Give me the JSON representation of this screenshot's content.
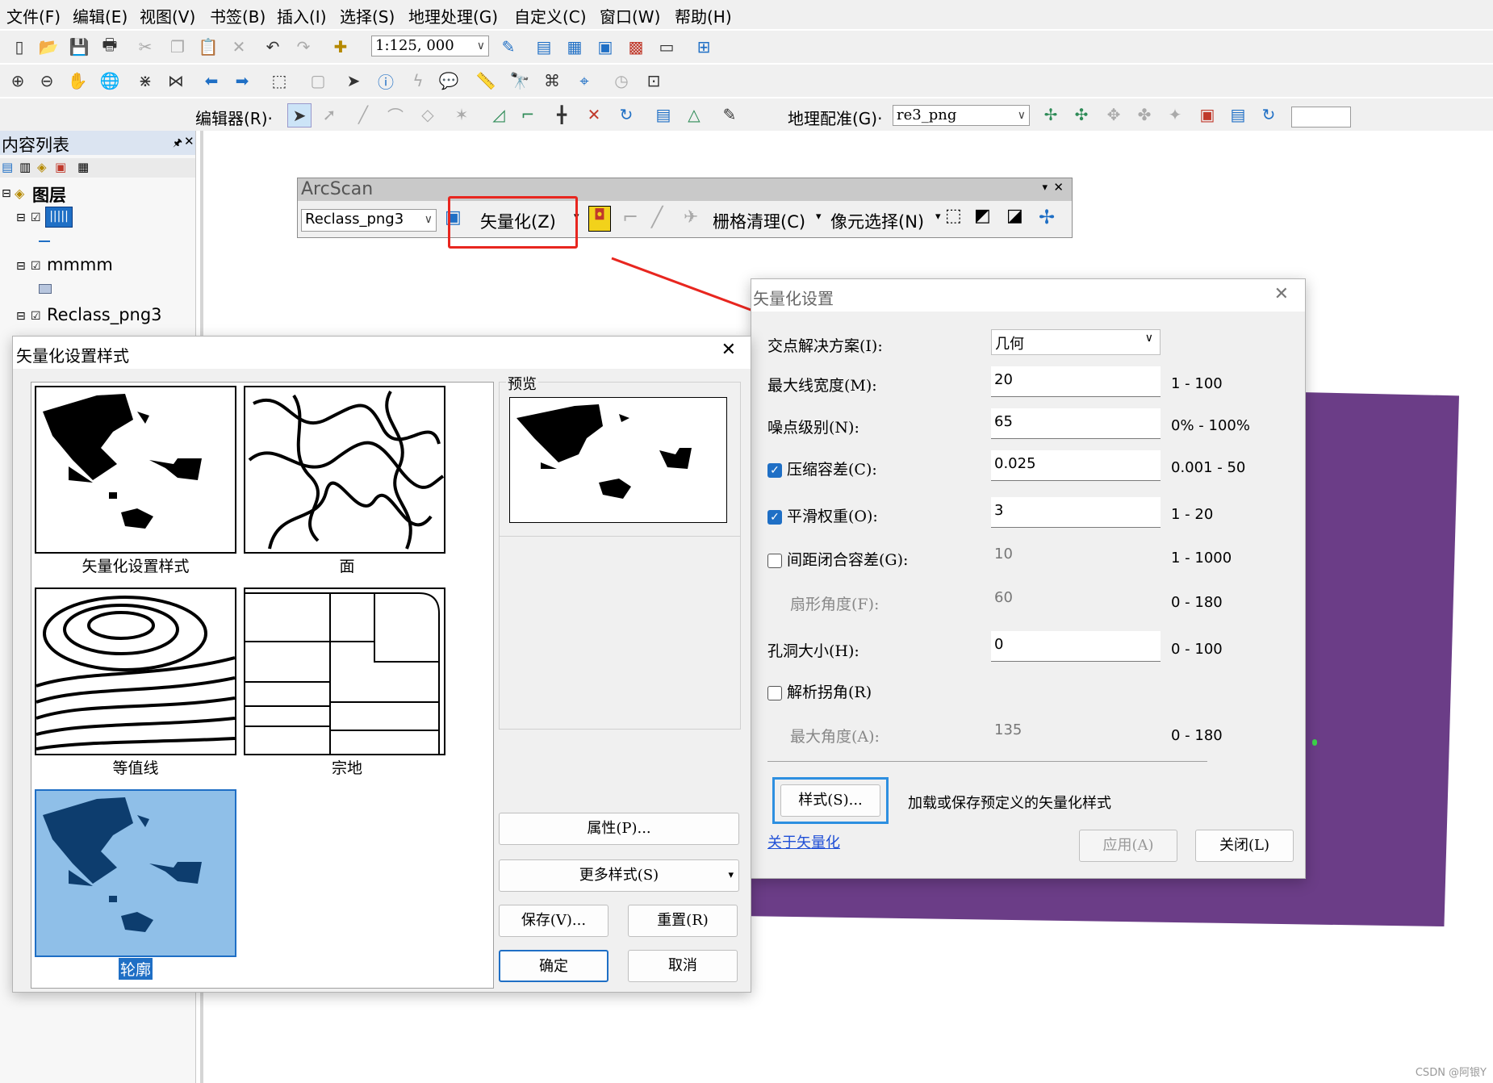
{
  "menu": [
    "文件(F)",
    "编辑(E)",
    "视图(V)",
    "书签(B)",
    "插入(I)",
    "选择(S)",
    "地理处理(G)",
    "自定义(C)",
    "窗口(W)",
    "帮助(H)"
  ],
  "toolbar": {
    "scale": "1:125, 000",
    "editor": "编辑器(R)·",
    "georef": "地理配准(G)·",
    "georef_layer": "re3_png"
  },
  "toc": {
    "title": "内容列表",
    "root": "图层",
    "layer1": "mmmm",
    "layer2": "Reclass_png3"
  },
  "arcscan": {
    "title": "ArcScan",
    "layer": "Reclass_png3",
    "vectorize": "矢量化(Z)",
    "raster_cleanup": "栅格清理(C)",
    "cell_select": "像元选择(N)"
  },
  "style_dialog": {
    "title": "矢量化设置样式",
    "preview_label": "预览",
    "styles": [
      "矢量化设置样式",
      "面",
      "等值线",
      "宗地",
      "轮廓"
    ],
    "buttons": {
      "properties": "属性(P)...",
      "more": "更多样式(S)",
      "save": "保存(V)...",
      "reset": "重置(R)",
      "ok": "确定",
      "cancel": "取消"
    }
  },
  "settings_dialog": {
    "title": "矢量化设置",
    "intersection_label": "交点解决方案(I):",
    "intersection_value": "几何",
    "rows": [
      {
        "label": "最大线宽度(M):",
        "value": "20",
        "range": "1 - 100"
      },
      {
        "label": "噪点级别(N):",
        "value": "65",
        "range": "0% - 100%"
      },
      {
        "label": "压缩容差(C):",
        "value": "0.025",
        "range": "0.001 - 50"
      },
      {
        "label": "平滑权重(O):",
        "value": "3",
        "range": "1 - 20"
      },
      {
        "label": "间距闭合容差(G):",
        "value": "10",
        "range": "1 - 1000"
      },
      {
        "label": "扇形角度(F):",
        "value": "60",
        "range": "0 - 180"
      },
      {
        "label": "孔洞大小(H):",
        "value": "0",
        "range": "0 - 100"
      },
      {
        "label": "解析拐角(R)",
        "value": "",
        "range": ""
      },
      {
        "label": "最大角度(A):",
        "value": "135",
        "range": "0 - 180"
      }
    ],
    "checked": {
      "compress": true,
      "smooth": true,
      "gap": false,
      "corner": false
    },
    "style_button": "样式(S)...",
    "style_hint": "加载或保存预定义的矢量化样式",
    "about_link": "关于矢量化",
    "apply": "应用(A)",
    "close": "关闭(L)"
  },
  "watermark": "CSDN @阿银Y",
  "colors": {
    "highlight_red": "#e8261f",
    "arrow_blue": "#2d8fe0",
    "purple": "#6b3d87",
    "style_select": "#1f6fc5"
  }
}
